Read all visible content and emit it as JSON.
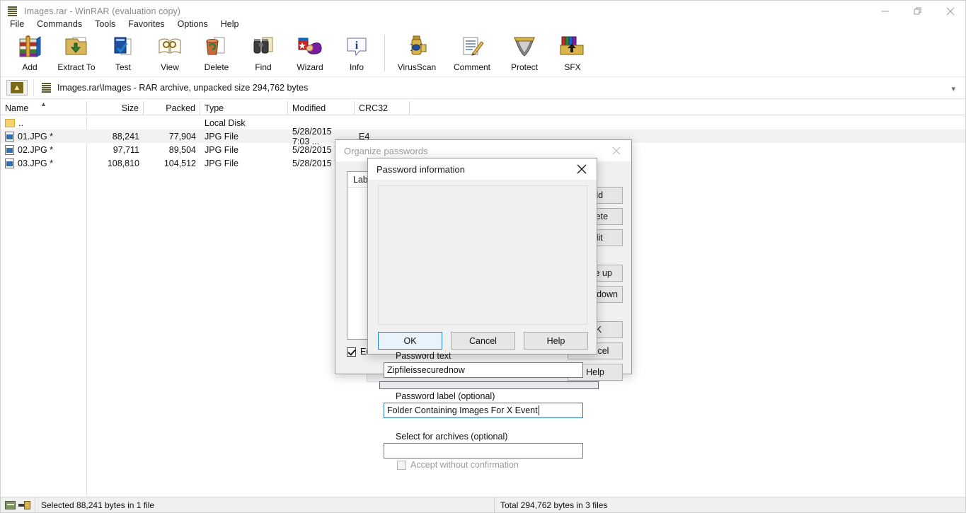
{
  "window": {
    "title": "Images.rar - WinRAR (evaluation copy)",
    "icon": "winrar-books-icon",
    "controls": {
      "minimize": "minimize-icon",
      "maximize": "restore-icon",
      "close": "close-icon"
    }
  },
  "menu": {
    "items": [
      "File",
      "Commands",
      "Tools",
      "Favorites",
      "Options",
      "Help"
    ]
  },
  "toolbar": {
    "buttons": [
      {
        "label": "Add",
        "icon": "add-archive-icon"
      },
      {
        "label": "Extract To",
        "icon": "extract-to-icon"
      },
      {
        "label": "Test",
        "icon": "test-icon"
      },
      {
        "label": "View",
        "icon": "view-icon"
      },
      {
        "label": "Delete",
        "icon": "delete-icon"
      },
      {
        "label": "Find",
        "icon": "find-binoculars-icon"
      },
      {
        "label": "Wizard",
        "icon": "wizard-icon"
      },
      {
        "label": "Info",
        "icon": "info-icon"
      },
      {
        "label": "VirusScan",
        "icon": "virusscan-icon"
      },
      {
        "label": "Comment",
        "icon": "comment-icon"
      },
      {
        "label": "Protect",
        "icon": "protect-shield-icon"
      },
      {
        "label": "SFX",
        "icon": "sfx-icon"
      }
    ]
  },
  "addressbar": {
    "up_button": "up-one-level-icon",
    "archive_icon": "winrar-books-icon",
    "path_text": "Images.rar\\Images - RAR archive, unpacked size 294,762 bytes",
    "dropdown": "chevron-down-icon"
  },
  "filelist": {
    "columns": [
      "Name",
      "Size",
      "Packed",
      "Type",
      "Modified",
      "CRC32"
    ],
    "sort_indicator": "ascending-caret",
    "rows": [
      {
        "name": "..",
        "icon": "folder-up-icon",
        "size": "",
        "packed": "",
        "type": "Local Disk",
        "modified": "",
        "crc32": ""
      },
      {
        "name": "01.JPG *",
        "icon": "jpg-file-icon",
        "size": "88,241",
        "packed": "77,904",
        "type": "JPG File",
        "modified": "5/28/2015 7:03 ...",
        "crc32": "E4",
        "selected": true
      },
      {
        "name": "02.JPG *",
        "icon": "jpg-file-icon",
        "size": "97,711",
        "packed": "89,504",
        "type": "JPG File",
        "modified": "5/28/2015 7:",
        "crc32": "",
        "selected": false
      },
      {
        "name": "03.JPG *",
        "icon": "jpg-file-icon",
        "size": "108,810",
        "packed": "104,512",
        "type": "JPG File",
        "modified": "5/28/2015 7:",
        "crc32": "",
        "selected": false
      }
    ]
  },
  "statusbar": {
    "left_icon_1": "archive-status-icon",
    "left_icon_2": "key-lock-icon",
    "selected_text": "Selected 88,241 bytes in 1 file",
    "total_text": "Total 294,762 bytes in 3 files"
  },
  "organize_dialog": {
    "title": "Organize passwords",
    "close_icon": "close-icon",
    "list_header": "Label",
    "buttons": [
      "Add",
      "Delete",
      "Edit",
      "Move up",
      "Move down",
      "OK",
      "Cancel",
      "Help"
    ],
    "autocomplete_label": "Enable autocomplete",
    "autocomplete_checked": true
  },
  "password_dialog": {
    "title": "Password information",
    "close_icon": "close-icon",
    "password_text_label": "Password text",
    "password_text_value": "Zipfileissecurednow",
    "password_label_label": "Password label (optional)",
    "password_label_value": "Folder Containing Images For X Event",
    "select_archives_label": "Select for archives (optional)",
    "select_archives_value": "",
    "select_archives_placeholder": "",
    "accept_label": "Accept without confirmation",
    "accept_checked": false,
    "accept_disabled": true,
    "buttons": {
      "ok": "OK",
      "cancel": "Cancel",
      "help": "Help"
    }
  },
  "colors": {
    "window_bg": "#ffffff",
    "dialog_bg": "#f0f0f0",
    "accent": "#1f7fd0",
    "selected_row": "#f2f2f2",
    "inactive_text": "#9a9a9a"
  }
}
